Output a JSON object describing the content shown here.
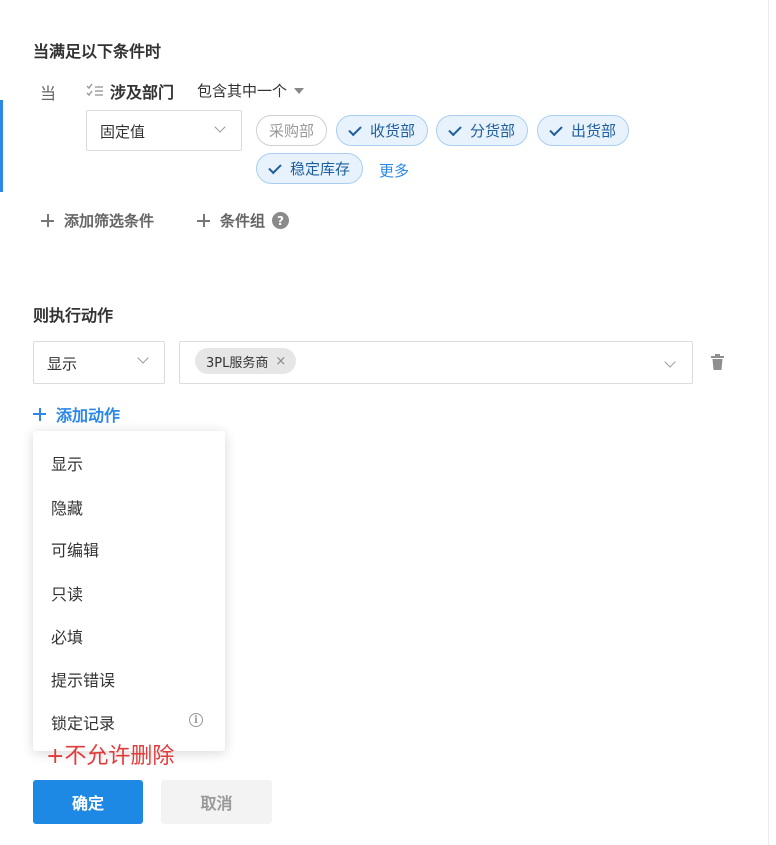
{
  "condition_section": {
    "title": "当满足以下条件时",
    "when_label": "当",
    "field_icon": "field-type-icon",
    "field_name": "涉及部门",
    "operator": "包含其中一个",
    "value_type": "固定值",
    "options": [
      {
        "label": "采购部",
        "checked": false
      },
      {
        "label": "收货部",
        "checked": true
      },
      {
        "label": "分货部",
        "checked": true
      },
      {
        "label": "出货部",
        "checked": true
      },
      {
        "label": "稳定库存",
        "checked": true
      }
    ],
    "more_label": "更多",
    "add_filter_label": "添加筛选条件",
    "add_group_label": "条件组",
    "help_symbol": "?"
  },
  "action_section": {
    "title": "则执行动作",
    "action_type": "显示",
    "selected_value": "3PL服务商",
    "remove_symbol": "×",
    "add_action_label": "添加动作"
  },
  "dropdown": {
    "items": [
      "显示",
      "隐藏",
      "可编辑",
      "只读",
      "必填",
      "提示错误",
      "锁定记录"
    ],
    "info_symbol": "i"
  },
  "annotation": "+不允许删除",
  "footer": {
    "confirm_label": "确定",
    "cancel_label": "取消"
  },
  "colors": {
    "accent": "#1e88e5",
    "link": "#2b87e8",
    "checked_tag_bg": "#e7f2fd",
    "annotation": "#e23b3b"
  }
}
